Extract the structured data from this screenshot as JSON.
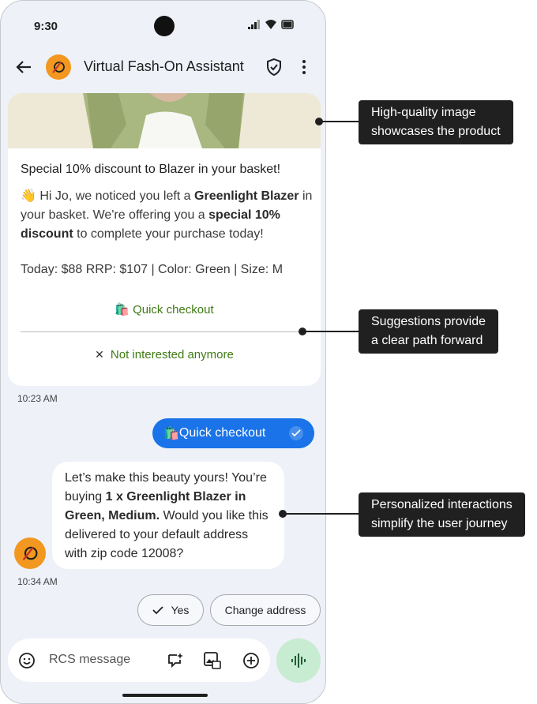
{
  "status_bar": {
    "time": "9:30"
  },
  "app_bar": {
    "title": "Virtual Fash-On Assistant"
  },
  "rich_card": {
    "title": "Special 10% discount to Blazer in your basket!",
    "body": {
      "emoji": "👋",
      "part1": " Hi Jo, we noticed you left a ",
      "bold1": "Greenlight Blazer",
      "part2": " in your basket. We're offering you a ",
      "bold2": "special 10% discount",
      "part3": " to complete your purchase today!"
    },
    "details": "Today: $88 RRP: $107 | Color: Green | Size: M",
    "suggestions": [
      {
        "icon": "🛍️",
        "label": "Quick checkout"
      },
      {
        "icon": "✕",
        "label": "Not interested anymore"
      }
    ]
  },
  "timestamps": [
    "10:23 AM",
    "10:34 AM"
  ],
  "sent_message": {
    "icon": "🛍️",
    "text": "Quick checkout"
  },
  "received_message": {
    "part1": "Let’s make this beauty yours! You’re buying ",
    "bold": "1 x Greenlight Blazer in Green, Medium.",
    "part2": " Would you like this delivered to your default address with zip code 12008?"
  },
  "reply_chips": [
    {
      "label": "Yes",
      "icon": "check-icon"
    },
    {
      "label": "Change address"
    }
  ],
  "compose": {
    "placeholder": "RCS message"
  },
  "callouts": [
    {
      "line1": "High-quality image",
      "line2": "showcases the product"
    },
    {
      "line1": "Suggestions provide",
      "line2": "a clear path forward"
    },
    {
      "line1": "Personalized interactions",
      "line2": "simplify the user journey"
    }
  ],
  "colors": {
    "accent_blue": "#1a73e8",
    "suggestion_green": "#3f7a14",
    "brand_orange": "#f29720",
    "mic_green": "#c7ecd2",
    "chat_background": "#eef1f8"
  }
}
